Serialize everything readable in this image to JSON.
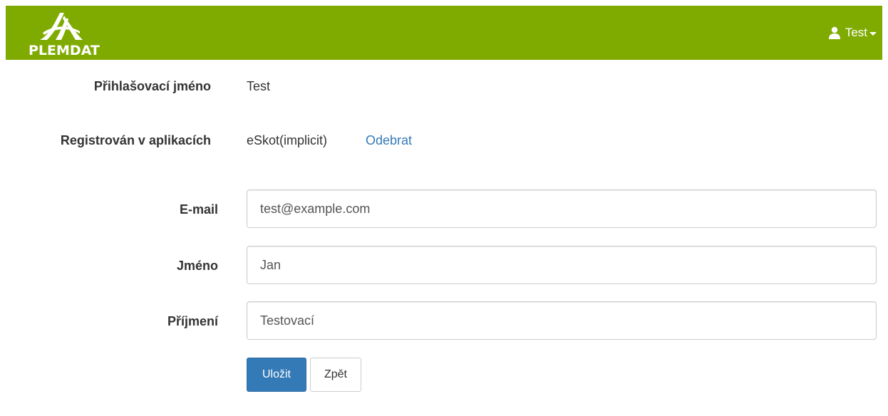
{
  "header": {
    "logo_text": "PLEMDAT",
    "user_name": "Test",
    "colors": {
      "navbar_bg": "#7fab00",
      "text": "#ffffff"
    },
    "icons": {
      "user": "user-icon",
      "caret": "caret-down-icon"
    }
  },
  "account": {
    "login_label": "Přihlašovací jméno",
    "login_value": "Test",
    "apps_label": "Registrován v aplikacích",
    "apps_value": "eSkot(implicit)",
    "remove_link": "Odebrat"
  },
  "form": {
    "email_label": "E-mail",
    "email_value": "test@example.com",
    "first_name_label": "Jméno",
    "first_name_value": "Jan",
    "last_name_label": "Příjmení",
    "last_name_value": "Testovací",
    "save_label": "Uložit",
    "back_label": "Zpět"
  },
  "colors": {
    "primary": "#337ab7",
    "link": "#337ab7"
  }
}
